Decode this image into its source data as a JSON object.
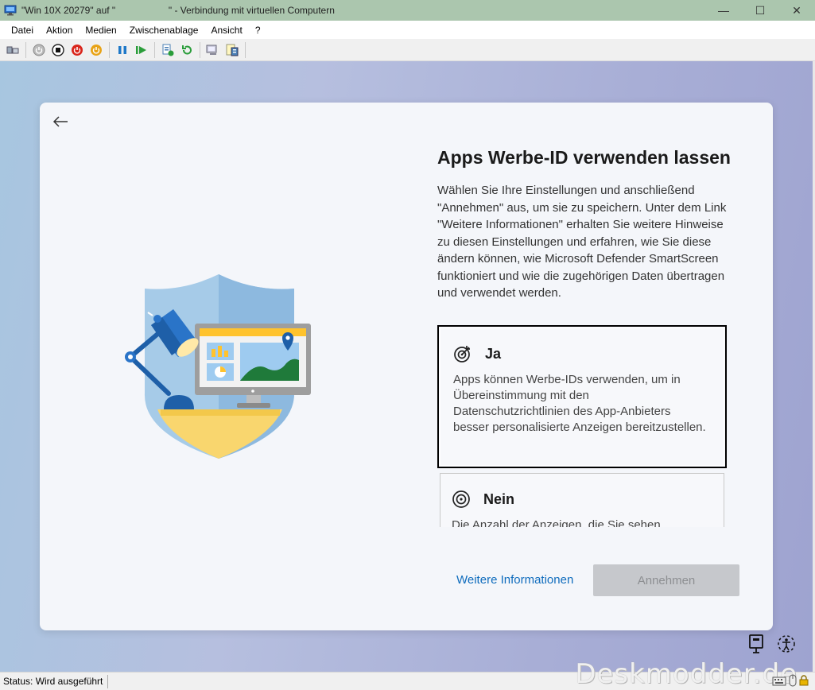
{
  "window": {
    "title": "\"Win 10X 20279\" auf \"                    \" - Verbindung mit virtuellen Computern",
    "controls": {
      "minimize": "—",
      "maximize": "☐",
      "close": "✕"
    }
  },
  "menu": [
    {
      "label": "Datei"
    },
    {
      "label": "Aktion"
    },
    {
      "label": "Medien"
    },
    {
      "label": "Zwischenablage"
    },
    {
      "label": "Ansicht"
    },
    {
      "label": "?"
    }
  ],
  "toolbar": {
    "icons": [
      "ctrl-alt-del-icon",
      "start-icon",
      "turn-off-icon",
      "shutdown-icon",
      "save-icon",
      "pause-icon",
      "resume-icon",
      "checkpoint-icon",
      "revert-icon",
      "enhanced-session-icon",
      "share-icon"
    ]
  },
  "colors": {
    "accent": "#0f6cbd",
    "button_disabled": "#c6c8cc",
    "titlebar": "#abc6ae"
  },
  "oobe": {
    "heading": "Apps Werbe-ID verwenden lassen",
    "description": "Wählen Sie Ihre Einstellungen und anschließend \"Annehmen\" aus, um sie zu speichern. Unter dem Link \"Weitere Informationen\" erhalten Sie weitere Hinweise zu diesen Einstellungen und erfahren, wie Sie diese ändern können, wie Microsoft Defender SmartScreen funktioniert und wie die zugehörigen Daten übertragen und verwendet werden.",
    "options": {
      "ja": {
        "title": "Ja",
        "text": "Apps können Werbe-IDs verwenden, um in Übereinstimmung mit den Datenschutzrichtlinien des App-Anbieters besser personalisierte Anzeigen bereitzustellen.",
        "icon": "target-arrow-icon",
        "selected": true
      },
      "nein": {
        "title": "Nein",
        "text": "Die Anzahl der Anzeigen, die Sie sehen",
        "icon": "target-icon"
      }
    },
    "more_info": "Weitere Informationen",
    "accept": "Annehmen"
  },
  "status": {
    "text": "Status: Wird ausgeführt"
  },
  "watermark": "Deskmodder.de"
}
